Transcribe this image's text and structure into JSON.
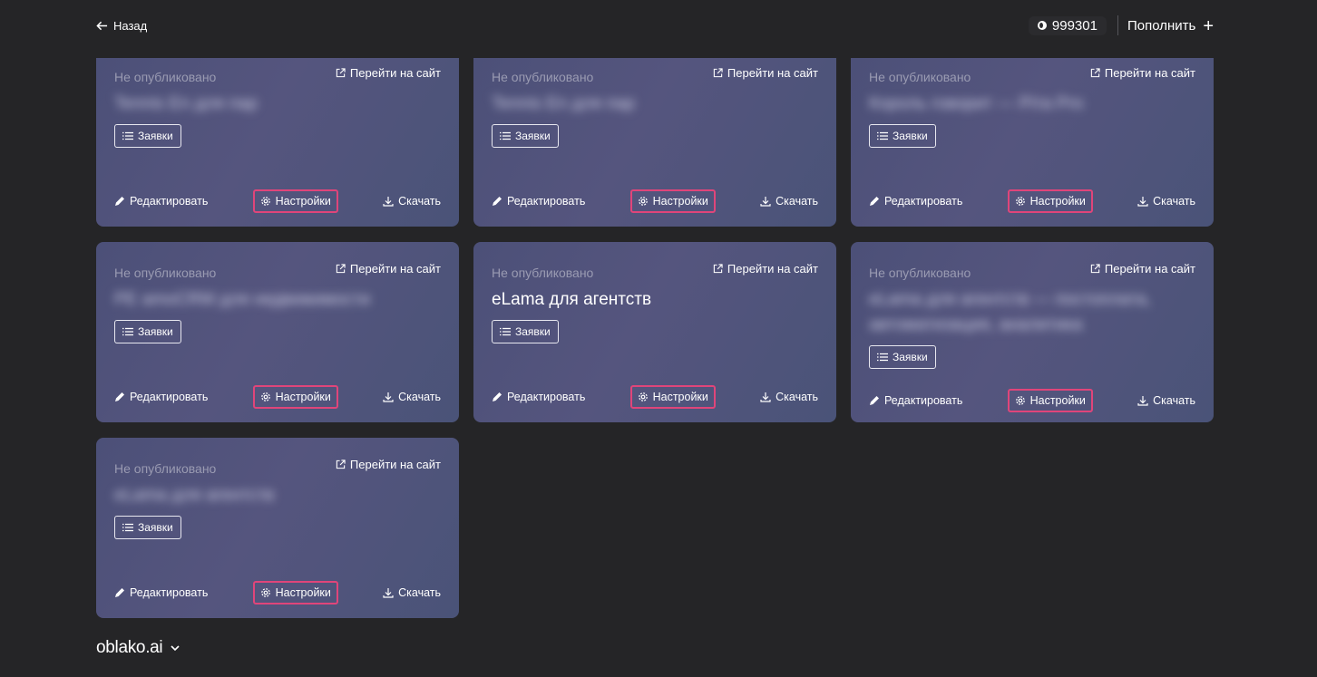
{
  "header": {
    "back_label": "Назад",
    "balance": "999301",
    "topup_label": "Пополнить",
    "topup_icon": "+"
  },
  "card_common": {
    "status": "Не опубликовано",
    "goto_label": "Перейти на сайт",
    "requests_label": "Заявки",
    "edit_label": "Редактировать",
    "settings_label": "Настройки",
    "download_label": "Скачать"
  },
  "cards": [
    {
      "title": "Tennis En для пар",
      "blurred": true
    },
    {
      "title": "Tennis En для пар",
      "blurred": true
    },
    {
      "title": "Король говорит — Ріта Pro",
      "blurred": true
    },
    {
      "title": "PE amoCRM для недвижимости",
      "blurred": true
    },
    {
      "title": "eLama для агентств",
      "blurred": false
    },
    {
      "title": "eLama для агентств — постоплата, автоматизация, аналитика",
      "blurred": true
    },
    {
      "title": "eLama для агентств",
      "blurred": true
    }
  ],
  "footer": {
    "logo": "oblako.ai"
  },
  "colors": {
    "background": "#252527",
    "card": "#4f5279",
    "highlight": "#e0457a"
  }
}
